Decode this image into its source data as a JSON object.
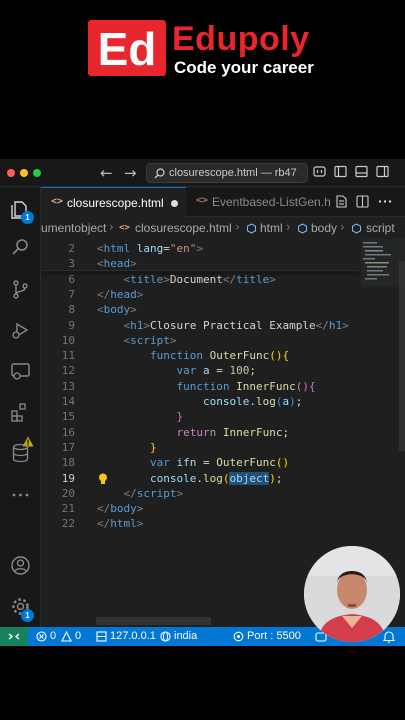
{
  "brand": {
    "logo_letters": "Ed",
    "name": "Edupoly",
    "tagline": "Code your career"
  },
  "titlebar": {
    "command_center": "closurescope.html — rb47"
  },
  "activity_bar": {
    "explorer_badge": "1",
    "settings_badge": "1"
  },
  "tabs": [
    {
      "label": "closurescope.html",
      "icon": "<>",
      "state": "active, unsaved"
    },
    {
      "label": "Eventbased-ListGen.h",
      "icon": "<>",
      "state": "inactive"
    }
  ],
  "breadcrumbs": {
    "item1": "umentobject",
    "item2": "closurescope.html",
    "item3": "html",
    "item4": "body",
    "item5": "script"
  },
  "editor": {
    "current_line": 19,
    "lines": [
      {
        "n": "2",
        "tokens": [
          [
            "t-punc",
            "<"
          ],
          [
            "t-tag",
            "html "
          ],
          [
            "t-attr",
            "lang"
          ],
          [
            "t-text",
            "="
          ],
          [
            "t-str",
            "\"en\""
          ],
          [
            "t-punc",
            ">"
          ]
        ]
      },
      {
        "n": "3",
        "tokens": [
          [
            "t-punc",
            "<"
          ],
          [
            "t-tag",
            "head"
          ],
          [
            "t-punc",
            ">"
          ]
        ]
      },
      {
        "n": "6",
        "tokens": [
          [
            "t-text",
            "    "
          ],
          [
            "t-punc",
            "<"
          ],
          [
            "t-tag",
            "title"
          ],
          [
            "t-punc",
            ">"
          ],
          [
            "t-text",
            "Document"
          ],
          [
            "t-punc",
            "</"
          ],
          [
            "t-tag",
            "title"
          ],
          [
            "t-punc",
            ">"
          ]
        ]
      },
      {
        "n": "7",
        "tokens": [
          [
            "t-punc",
            "</"
          ],
          [
            "t-tag",
            "head"
          ],
          [
            "t-punc",
            ">"
          ]
        ]
      },
      {
        "n": "8",
        "tokens": [
          [
            "t-punc",
            "<"
          ],
          [
            "t-tag",
            "body"
          ],
          [
            "t-punc",
            ">"
          ]
        ]
      },
      {
        "n": "9",
        "tokens": [
          [
            "t-text",
            "    "
          ],
          [
            "t-punc",
            "<"
          ],
          [
            "t-tag",
            "h1"
          ],
          [
            "t-punc",
            ">"
          ],
          [
            "t-text",
            "Closure Practical Example"
          ],
          [
            "t-punc",
            "</"
          ],
          [
            "t-tag",
            "h1"
          ],
          [
            "t-punc",
            ">"
          ]
        ]
      },
      {
        "n": "10",
        "tokens": [
          [
            "t-text",
            "    "
          ],
          [
            "t-punc",
            "<"
          ],
          [
            "t-tag",
            "script"
          ],
          [
            "t-punc",
            ">"
          ]
        ]
      },
      {
        "n": "11",
        "tokens": [
          [
            "t-text",
            "        "
          ],
          [
            "t-kw",
            "function "
          ],
          [
            "t-fn",
            "OuterFunc"
          ],
          [
            "t-br1",
            "()"
          ],
          [
            "t-br1",
            "{"
          ]
        ]
      },
      {
        "n": "12",
        "tokens": [
          [
            "t-text",
            "            "
          ],
          [
            "t-kw",
            "var "
          ],
          [
            "t-var",
            "a"
          ],
          [
            "t-text",
            " = "
          ],
          [
            "t-num",
            "100"
          ],
          [
            "t-text",
            ";"
          ]
        ]
      },
      {
        "n": "13",
        "tokens": [
          [
            "t-text",
            "            "
          ],
          [
            "t-kw",
            "function "
          ],
          [
            "t-fn",
            "InnerFunc"
          ],
          [
            "t-br2",
            "()"
          ],
          [
            "t-br2",
            "{"
          ]
        ]
      },
      {
        "n": "14",
        "tokens": [
          [
            "t-text",
            "                "
          ],
          [
            "t-var",
            "console"
          ],
          [
            "t-text",
            "."
          ],
          [
            "t-fn",
            "log"
          ],
          [
            "t-br3",
            "("
          ],
          [
            "t-var",
            "a"
          ],
          [
            "t-br3",
            ")"
          ],
          [
            "t-text",
            ";"
          ]
        ]
      },
      {
        "n": "15",
        "tokens": [
          [
            "t-text",
            "            "
          ],
          [
            "t-br2",
            "}"
          ]
        ]
      },
      {
        "n": "16",
        "tokens": [
          [
            "t-text",
            "            "
          ],
          [
            "t-ctrl",
            "return "
          ],
          [
            "t-fn",
            "InnerFunc"
          ],
          [
            "t-text",
            ";"
          ]
        ]
      },
      {
        "n": "17",
        "tokens": [
          [
            "t-text",
            "        "
          ],
          [
            "t-br1",
            "}"
          ]
        ]
      },
      {
        "n": "18",
        "tokens": [
          [
            "t-text",
            "        "
          ],
          [
            "t-kw",
            "var "
          ],
          [
            "t-var",
            "ifn"
          ],
          [
            "t-text",
            " = "
          ],
          [
            "t-fn",
            "OuterFunc"
          ],
          [
            "t-br1",
            "()"
          ]
        ]
      },
      {
        "n": "19",
        "tokens": [
          [
            "t-text",
            "        "
          ],
          [
            "t-var",
            "console"
          ],
          [
            "t-text",
            "."
          ],
          [
            "t-fn",
            "log"
          ],
          [
            "t-br1",
            "("
          ],
          [
            "t-sel",
            "object"
          ],
          [
            "t-br1",
            ")"
          ],
          [
            "t-text",
            ";"
          ]
        ]
      },
      {
        "n": "20",
        "tokens": [
          [
            "t-text",
            "    "
          ],
          [
            "t-punc",
            "</"
          ],
          [
            "t-tag",
            "script"
          ],
          [
            "t-punc",
            ">"
          ]
        ]
      },
      {
        "n": "21",
        "tokens": [
          [
            "t-punc",
            "</"
          ],
          [
            "t-tag",
            "body"
          ],
          [
            "t-punc",
            ">"
          ]
        ]
      },
      {
        "n": "22",
        "tokens": [
          [
            "t-punc",
            "</"
          ],
          [
            "t-tag",
            "html"
          ],
          [
            "t-punc",
            ">"
          ]
        ]
      }
    ]
  },
  "statusbar": {
    "errors": "0",
    "warnings": "0",
    "host": "127.0.0.1",
    "location": "india",
    "port": "Port : 5500"
  },
  "colors": {
    "brand_red": "#e8262d",
    "accent_blue": "#0078d4",
    "remote_green": "#16825d",
    "editor_bg": "#1f1f1f"
  }
}
